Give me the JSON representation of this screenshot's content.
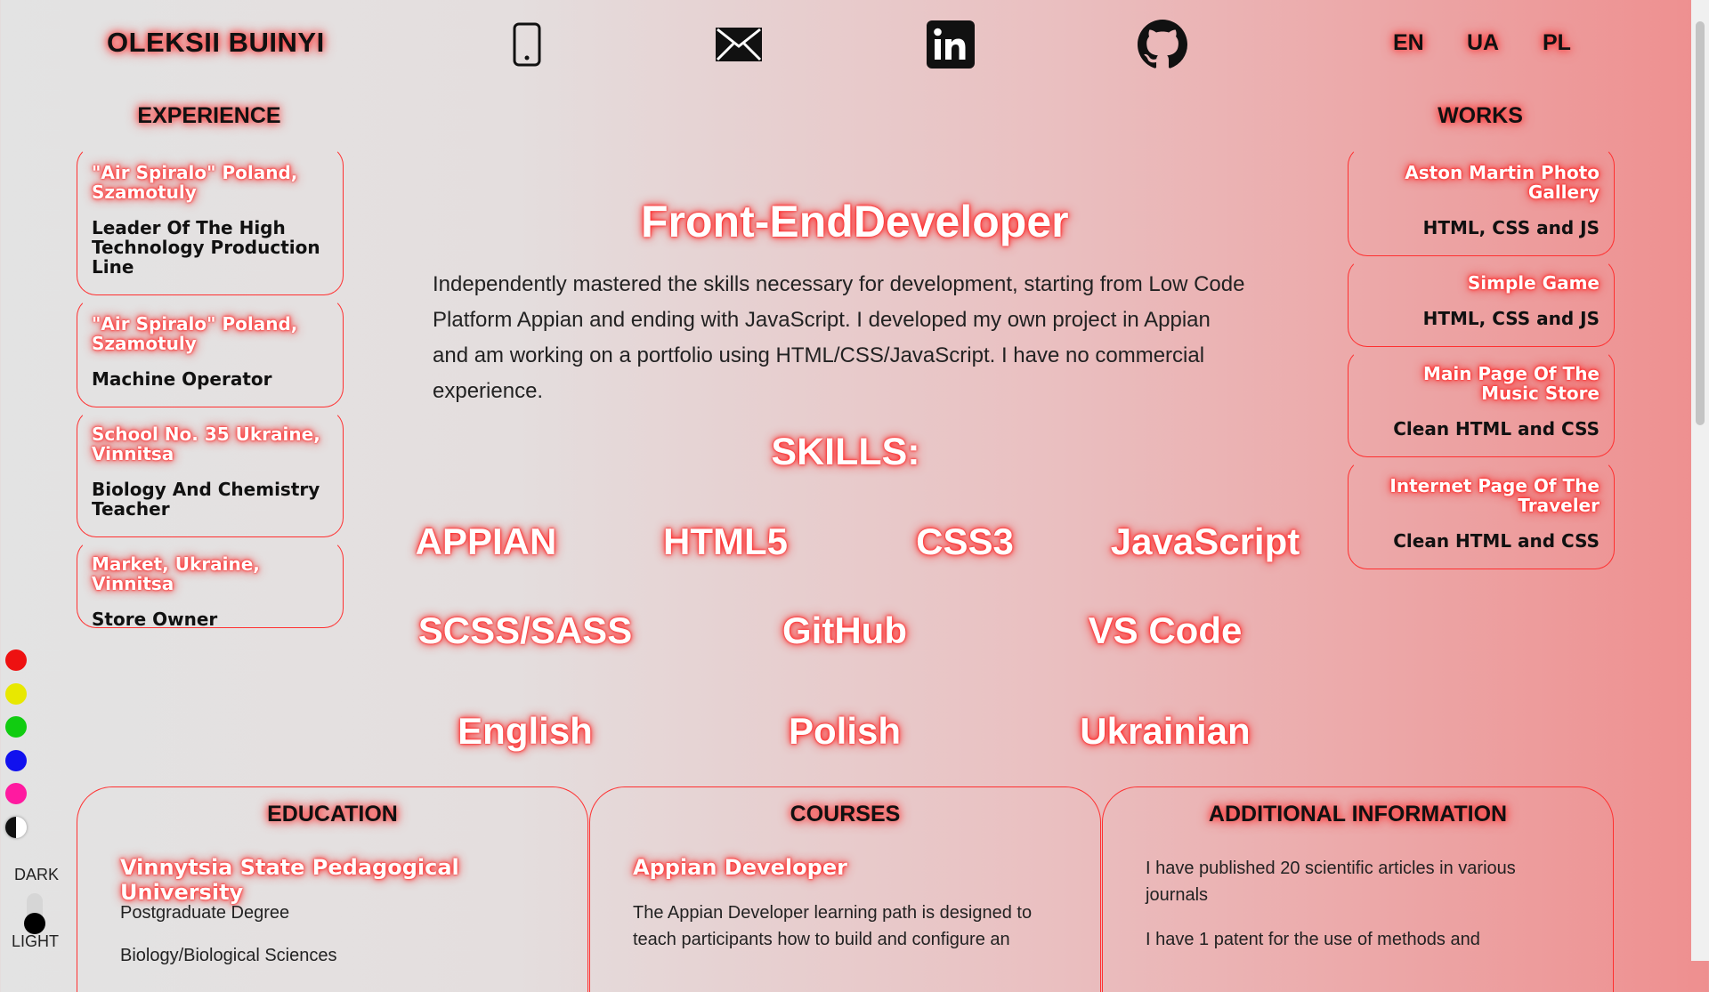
{
  "header": {
    "name": "OLEKSII BUINYI",
    "contacts": [
      {
        "icon": "phone-icon"
      },
      {
        "icon": "mail-icon"
      },
      {
        "icon": "linkedin-icon"
      },
      {
        "icon": "github-icon"
      }
    ],
    "languages": [
      "EN",
      "UA",
      "PL"
    ]
  },
  "experience": {
    "heading": "EXPERIENCE",
    "items": [
      {
        "place": "\"Air Spiralo\" Poland, Szamotuly",
        "role": "Leader Of The High Technology Production Line"
      },
      {
        "place": "\"Air Spiralo\" Poland, Szamotuly",
        "role": "Machine Operator"
      },
      {
        "place": "School No. 35 Ukraine, Vinnitsa",
        "role": "Biology And Chemistry Teacher"
      },
      {
        "place": "Market, Ukraine, Vinnitsa",
        "role": "Store Owner"
      }
    ]
  },
  "works": {
    "heading": "WORKS",
    "items": [
      {
        "title": "Aston Martin Photo Gallery",
        "tech": "HTML, CSS and JS"
      },
      {
        "title": "Simple Game",
        "tech": "HTML, CSS and JS"
      },
      {
        "title": "Main Page Of The Music Store",
        "tech": "Clean HTML and CSS"
      },
      {
        "title": "Internet Page Of The Traveler",
        "tech": "Clean HTML and CSS"
      }
    ]
  },
  "main": {
    "title": "Front-EndDeveloper",
    "intro": "Independently mastered the skills necessary for development, starting from Low Code Platform Appian and ending with JavaScript. I developed my own project in Appian and am working on a portfolio using HTML/CSS/JavaScript. I have no commercial experience.",
    "skills_heading": "SKILLS:",
    "skills_row1": [
      "APPIAN",
      "HTML5",
      "CSS3",
      "JavaScript"
    ],
    "skills_row2": [
      "SCSS/SASS",
      "GitHub",
      "VS Code"
    ],
    "skills_row3": [
      "English",
      "Polish",
      "Ukrainian"
    ]
  },
  "education": {
    "heading": "EDUCATION",
    "school": "Vinnytsia State Pedagogical University",
    "degree": "Postgraduate Degree",
    "field": "Biology/Biological Sciences"
  },
  "courses": {
    "heading": "COURSES",
    "name": "Appian Developer",
    "text": "The Appian Developer learning path is designed to teach participants how to build and configure an"
  },
  "additional": {
    "heading": "ADDITIONAL INFORMATION",
    "line1": "I have published 20 scientific articles in various journals",
    "line2": "I have 1 patent for the use of methods and"
  },
  "theme": {
    "colors": [
      "#ee1111",
      "#e8e800",
      "#11cc11",
      "#1111ee",
      "#ff1aa0"
    ],
    "dark_label": "DARK",
    "light_label": "LIGHT",
    "accent": "#ff3030"
  }
}
